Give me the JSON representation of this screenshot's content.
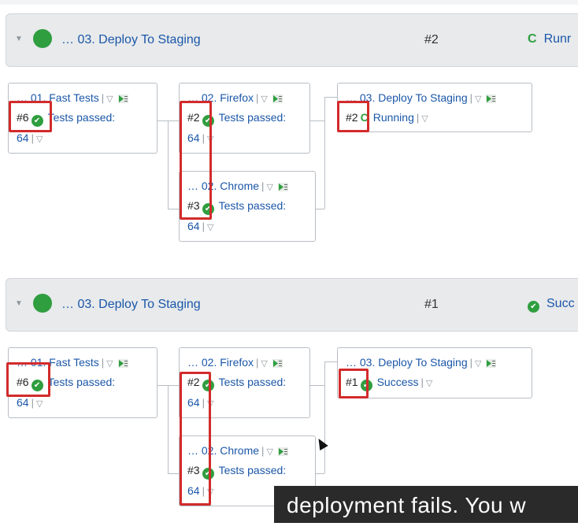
{
  "sections": [
    {
      "header": {
        "title": "… 03. Deploy To Staging",
        "build": "#2",
        "status": "Runr",
        "status_icon": "spinner-icon"
      },
      "cards": [
        {
          "title": "… 01. Fast Tests",
          "build": "#6",
          "status": "Tests passed:",
          "count": "64"
        },
        {
          "title": "… 02. Firefox",
          "build": "#2",
          "status": "Tests passed:",
          "count": "64"
        },
        {
          "title": "… 02. Chrome",
          "build": "#3",
          "status": "Tests passed:",
          "count": "64"
        },
        {
          "title": "… 03. Deploy To Staging",
          "build": "#2",
          "status": "Running"
        }
      ]
    },
    {
      "header": {
        "title": "… 03. Deploy To Staging",
        "build": "#1",
        "status": "Succ",
        "status_icon": "check-circle-icon"
      },
      "cards": [
        {
          "title": "… 01. Fast Tests",
          "build": "#6",
          "status": "Tests passed:",
          "count": "64"
        },
        {
          "title": "… 02. Firefox",
          "build": "#2",
          "status": "Tests passed:",
          "count": "64"
        },
        {
          "title": "… 02. Chrome",
          "build": "#3",
          "status": "Tests passed:",
          "count": "64"
        },
        {
          "title": "… 03. Deploy To Staging",
          "build": "#1",
          "status": "Success"
        }
      ]
    }
  ],
  "icons": {
    "sep": "|",
    "dropdown": "▽",
    "collapse": "▼",
    "check": "✔",
    "spinner": "C"
  },
  "caption": "deployment fails. You w",
  "colors": {
    "success": "#2f9e3f",
    "link": "#1b57a8",
    "highlight": "#d22b2b",
    "header_bg": "#e8eaec"
  }
}
